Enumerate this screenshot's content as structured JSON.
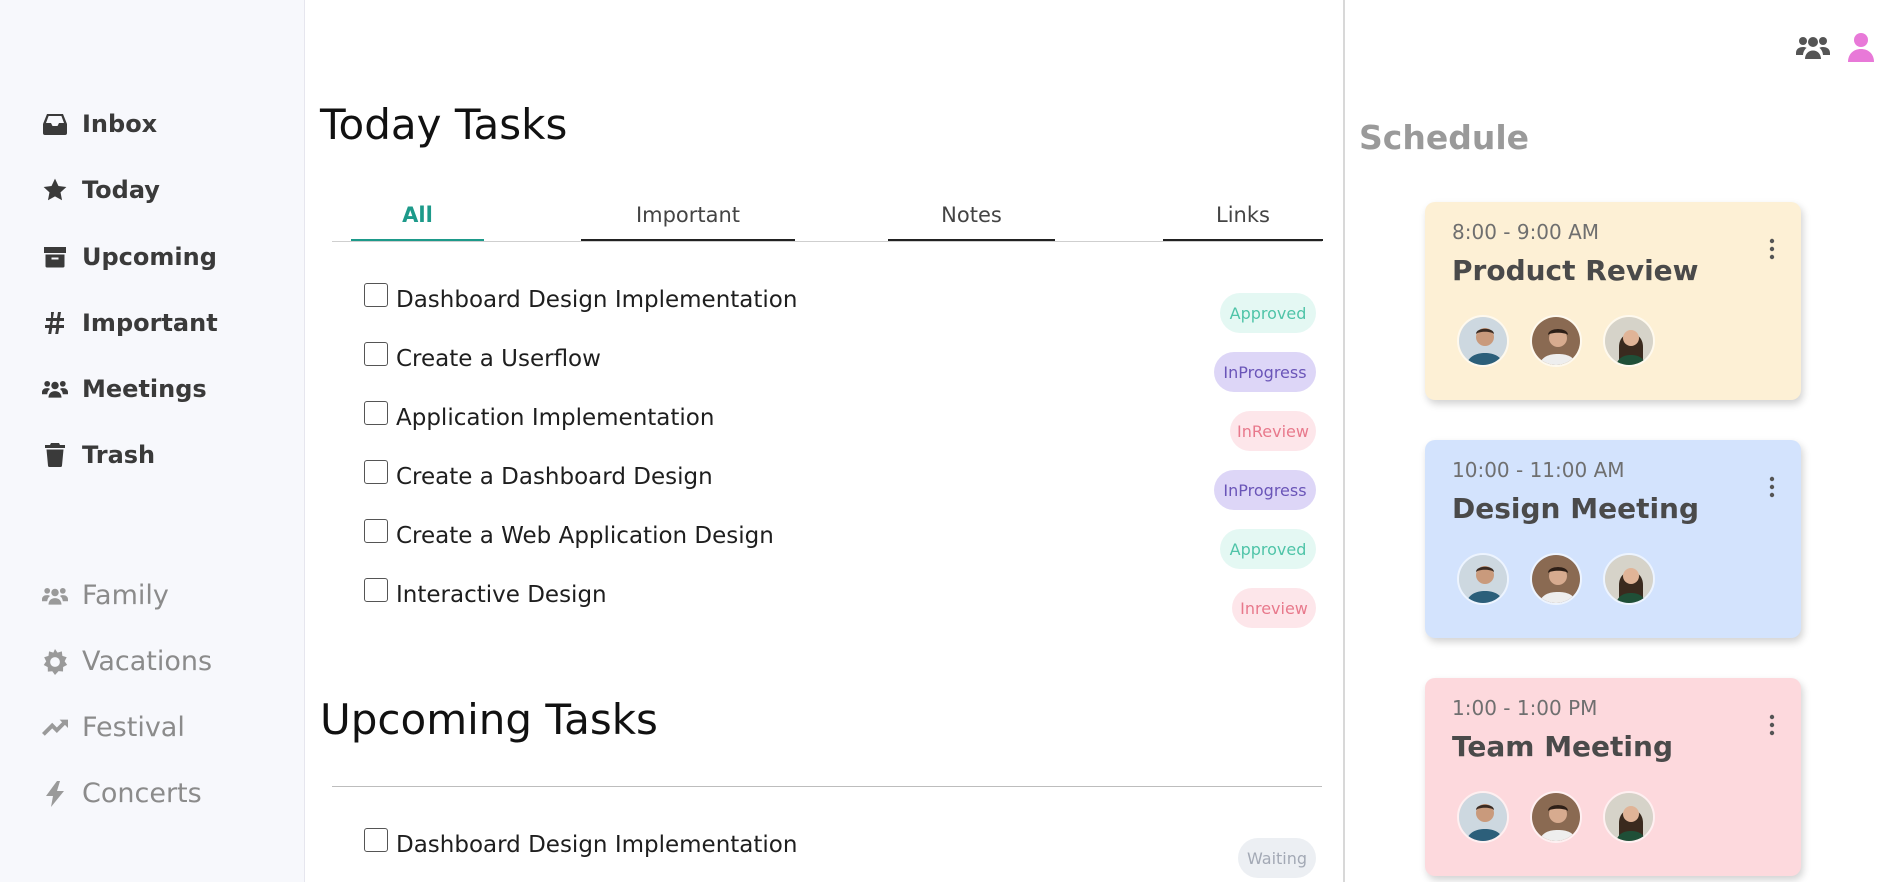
{
  "sidebar": {
    "main_items": [
      {
        "label": "Inbox",
        "icon": "inbox-icon"
      },
      {
        "label": "Today",
        "icon": "star-icon"
      },
      {
        "label": "Upcoming",
        "icon": "archive-icon"
      },
      {
        "label": "Important",
        "icon": "hash-icon"
      },
      {
        "label": "Meetings",
        "icon": "users-icon"
      },
      {
        "label": "Trash",
        "icon": "trash-icon"
      }
    ],
    "secondary_items": [
      {
        "label": "Family",
        "icon": "users-icon"
      },
      {
        "label": "Vacations",
        "icon": "cog-icon"
      },
      {
        "label": "Festival",
        "icon": "trending-up-icon"
      },
      {
        "label": "Concerts",
        "icon": "bolt-icon"
      }
    ]
  },
  "main": {
    "today_title": "Today Tasks",
    "tabs": [
      {
        "label": "All",
        "active": true
      },
      {
        "label": "Important",
        "active": false
      },
      {
        "label": "Notes",
        "active": false
      },
      {
        "label": "Links",
        "active": false
      }
    ],
    "tasks": [
      {
        "label": "Dashboard Design Implementation",
        "status": "Approved",
        "checked": false
      },
      {
        "label": "Create a Userflow",
        "status": "InProgress",
        "checked": false
      },
      {
        "label": "Application Implementation",
        "status": "InReview",
        "checked": false
      },
      {
        "label": "Create a Dashboard Design",
        "status": "InProgress",
        "checked": false
      },
      {
        "label": "Create a Web Application Design",
        "status": "Approved",
        "checked": false
      },
      {
        "label": "Interactive Design",
        "status": "Inreview",
        "checked": false
      }
    ],
    "upcoming_title": "Upcoming Tasks",
    "upcoming_tasks": [
      {
        "label": "Dashboard Design Implementation",
        "status": "Waiting",
        "checked": false
      }
    ]
  },
  "schedule": {
    "title": "Schedule",
    "events": [
      {
        "time": "8:00 - 9:00 AM",
        "title": "Product Review",
        "color": "#fdf0d5"
      },
      {
        "time": "10:00 - 11:00 AM",
        "title": "Design Meeting",
        "color": "#d3e3fd"
      },
      {
        "time": "1:00 - 1:00 PM",
        "title": "Team Meeting",
        "color": "#fdd9dd"
      }
    ]
  },
  "colors": {
    "accent": "#1d9a8a",
    "approved_bg": "#e4f8f3",
    "approved_fg": "#4fc4a8",
    "inprogress_bg": "#ddd6f7",
    "inprogress_fg": "#6a55b8",
    "inreview_bg": "#fde6ea",
    "inreview_fg": "#e8798c",
    "waiting_bg": "#eceff3",
    "waiting_fg": "#a3a9b5",
    "profile_icon": "#e879d8"
  }
}
